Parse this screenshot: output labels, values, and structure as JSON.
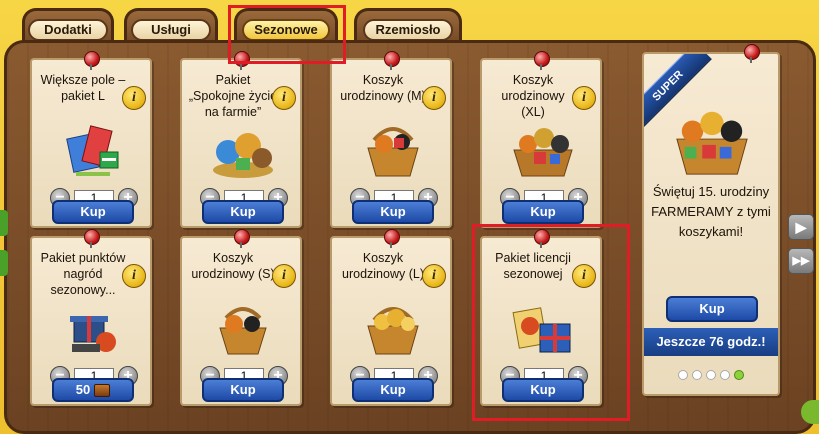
{
  "tabs": [
    {
      "label": "Dodatki",
      "active": false
    },
    {
      "label": "Usługi",
      "active": false
    },
    {
      "label": "Sezonowe",
      "active": true
    },
    {
      "label": "Rzemiosło",
      "active": false
    }
  ],
  "info_icon_glyph": "i",
  "stepper": {
    "minus": "−",
    "plus": "+"
  },
  "items": [
    {
      "title": "Większe pole – pakiet L",
      "qty": "1",
      "buy_label": "Kup",
      "art": "field-package-icon"
    },
    {
      "title": "Pakiet „Spokojne życie na farmie”",
      "qty": "1",
      "buy_label": "Kup",
      "art": "farm-life-package-icon"
    },
    {
      "title": "Koszyk urodzinowy (M)",
      "qty": "1",
      "buy_label": "Kup",
      "art": "birthday-basket-icon"
    },
    {
      "title": "Koszyk urodzinowy (XL)",
      "qty": "1",
      "buy_label": "Kup",
      "art": "birthday-basket-xl-icon"
    },
    {
      "title": "Pakiet punktów nagród sezonowy...",
      "qty": "1",
      "buy_label": "50",
      "art": "points-package-icon"
    },
    {
      "title": "Koszyk urodzinowy (S)",
      "qty": "1",
      "buy_label": "Kup",
      "art": "birthday-basket-s-icon"
    },
    {
      "title": "Koszyk urodzinowy (L)",
      "qty": "1",
      "buy_label": "Kup",
      "art": "birthday-basket-l-icon"
    },
    {
      "title": "Pakiet licencji sezonowej",
      "qty": "1",
      "buy_label": "Kup",
      "art": "license-package-icon"
    }
  ],
  "super": {
    "ribbon": "SUPER",
    "text": "Świętuj 15. urodziny FARMERAMY z tymi koszykami!",
    "buy_label": "Kup",
    "timer": "Jeszcze 76 godz.!",
    "dots": 5,
    "active_dot": 5
  },
  "nav": {
    "next": "▶",
    "last": "▶▶"
  },
  "colors": {
    "highlight": "#e01d27",
    "buy_blue": "#1d4aa6",
    "board_wood": "#6b4222"
  }
}
